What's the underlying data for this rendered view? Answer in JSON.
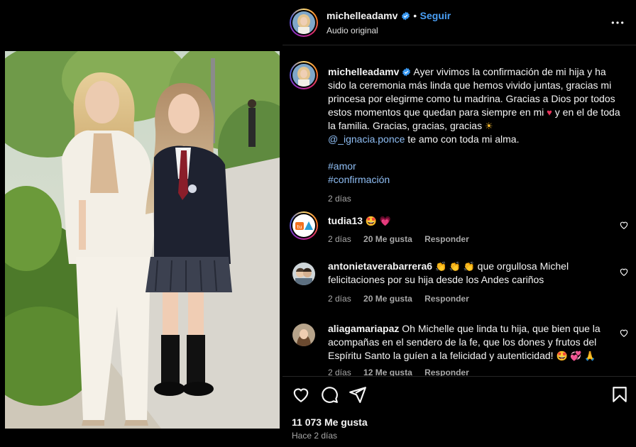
{
  "post": {
    "username": "michelleadamv",
    "follow_label": "Seguir",
    "separator": "•",
    "audio": "Audio original"
  },
  "caption": {
    "username": "michelleadamv",
    "text_1": "Ayer vivimos la confirmación de mi hija y ha sido la ceremonia más linda que hemos vivido juntas, gracias mi princesa por elegirme como tu madrina. Gracias a Dios por todos estos momentos que quedan para siempre en mi",
    "text_2": "y en el de toda la familia. Gracias, gracias, gracias",
    "mention": "@_ignacia.ponce",
    "text_3": "te amo con toda mi alma.",
    "hashtag_1": "#amor",
    "hashtag_2": "#confirmación",
    "time": "2 días"
  },
  "comments": [
    {
      "username": "tudia13",
      "text": "",
      "emojis": "🤩 💗",
      "time": "2 días",
      "likes": "20 Me gusta",
      "reply": "Responder"
    },
    {
      "username": "antonietaverabarrera6",
      "emojis": "👏 👏 👏",
      "text": "que orgullosa Michel felicitaciones por su hija desde los Andes cariños",
      "time": "2 días",
      "likes": "20 Me gusta",
      "reply": "Responder"
    },
    {
      "username": "aliagamariapaz",
      "text": "Oh Michelle que linda tu hija, que bien que la acompañas en el sendero de la fe, que los dones y frutos del Espíritu Santo la guíen a la felicidad y autenticidad!",
      "emojis": "🤩 💞 🙏",
      "time": "2 días",
      "likes": "12 Me gusta",
      "reply": "Responder"
    }
  ],
  "footer": {
    "likes": "11 073 Me gusta",
    "ago": "Hace 2 días"
  },
  "colors": {
    "background": "#000000",
    "text": "#f5f5f5",
    "link": "#8fbef4",
    "follow": "#4a9ff5",
    "muted": "#a8a8a8",
    "verified": "#3897f0"
  }
}
